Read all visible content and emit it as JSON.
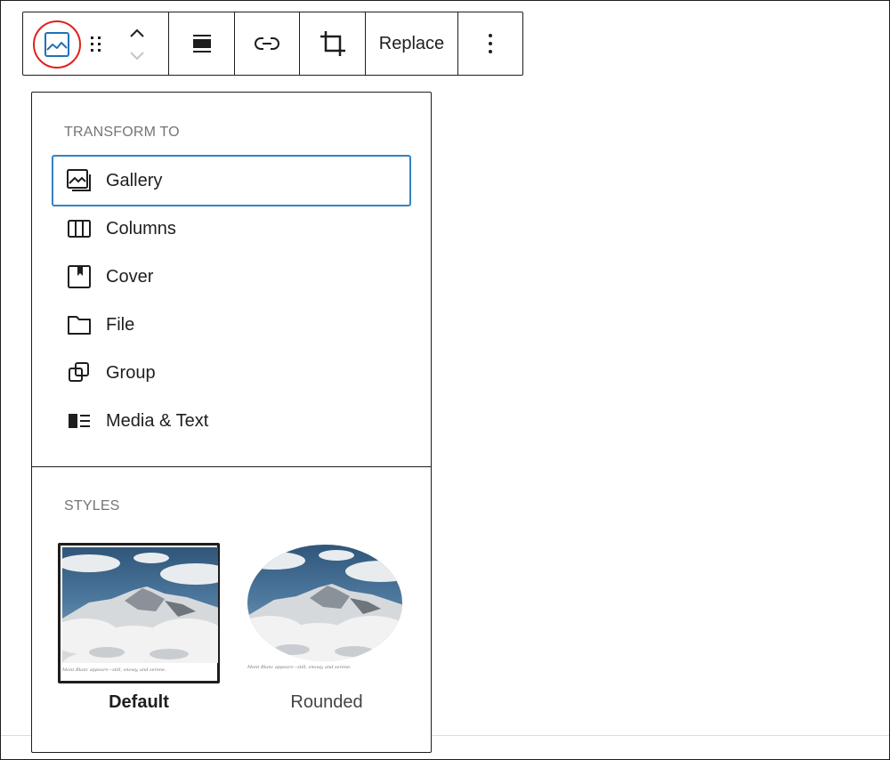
{
  "toolbar": {
    "replace_label": "Replace"
  },
  "transform": {
    "title": "TRANSFORM TO",
    "items": [
      {
        "label": "Gallery",
        "icon": "gallery-icon"
      },
      {
        "label": "Columns",
        "icon": "columns-icon"
      },
      {
        "label": "Cover",
        "icon": "cover-icon"
      },
      {
        "label": "File",
        "icon": "file-icon"
      },
      {
        "label": "Group",
        "icon": "group-icon"
      },
      {
        "label": "Media & Text",
        "icon": "media-text-icon"
      }
    ]
  },
  "styles": {
    "title": "STYLES",
    "options": [
      {
        "label": "Default",
        "caption": "Mont Blanc appears—still, snowy, and serene."
      },
      {
        "label": "Rounded",
        "caption": "Mont Blanc appears—still, snowy, and serene."
      }
    ]
  },
  "colors": {
    "accent": "#3582c4",
    "highlight_ring": "#e0211b",
    "block_icon": "#2271b1"
  }
}
